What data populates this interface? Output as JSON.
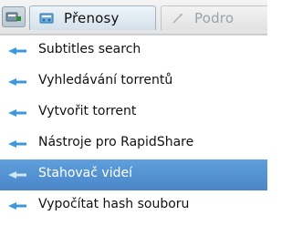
{
  "toolbar": {
    "menu_button_icon": "menu-icon",
    "tabs": [
      {
        "label": "Přenosy",
        "icon": "transfers-icon",
        "active": true
      },
      {
        "label": "Podro",
        "icon": "details-icon",
        "active": false
      }
    ]
  },
  "menu": {
    "bullet_icon": "arrow-bullet-icon",
    "selected_color": "#4f8fd3",
    "items": [
      {
        "label": "Subtitles search"
      },
      {
        "label": "Vyhledávání torrentů"
      },
      {
        "label": "Vytvořit torrent"
      },
      {
        "label": "Nástroje pro RapidShare"
      },
      {
        "label": "Stahovač videí",
        "selected": true
      },
      {
        "label": "Vypočítat hash souboru"
      }
    ]
  }
}
